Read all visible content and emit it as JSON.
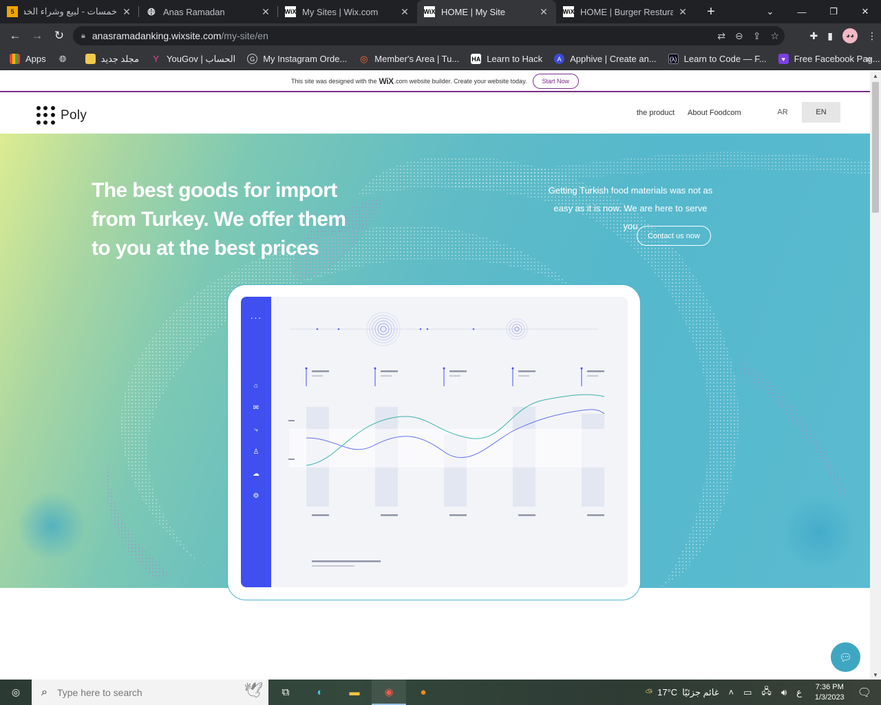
{
  "browser": {
    "tabs": [
      {
        "title": "خمسات - لبيع وشراء الخدمات",
        "favicon": "5",
        "active": false,
        "favicon_bg": "#f0a500"
      },
      {
        "title": "Anas Ramadan",
        "favicon": "globe",
        "active": false
      },
      {
        "title": "My Sites | Wix.com",
        "favicon": "WiX",
        "active": false
      },
      {
        "title": "HOME | My Site",
        "favicon": "WiX",
        "active": true
      },
      {
        "title": "HOME | Burger Resturant",
        "favicon": "WiX",
        "active": false
      }
    ],
    "url_domain": "anasramadanking.wixsite.com",
    "url_path": "/my-site/en",
    "bookmarks": [
      {
        "label": "Apps",
        "icon": "apps-grid-icon"
      },
      {
        "label": "",
        "icon": "globe-icon"
      },
      {
        "label": "مجلد جديد",
        "icon": "folder-icon"
      },
      {
        "label": "YouGov | الحساب",
        "icon": "yougov-icon"
      },
      {
        "label": "My Instagram Orde...",
        "icon": "instagram-orders-icon"
      },
      {
        "label": "Member's Area | Tu...",
        "icon": "members-icon"
      },
      {
        "label": "Learn to Hack",
        "icon": "hack-icon"
      },
      {
        "label": "Apphive | Create an...",
        "icon": "apphive-icon"
      },
      {
        "label": "Learn to Code — F...",
        "icon": "code-icon"
      },
      {
        "label": "Free Facebook Pag...",
        "icon": "heart-icon"
      }
    ]
  },
  "wix_banner": {
    "prefix": "This site was designed with the",
    "brand": "WiX",
    "suffix": ".com website builder. Create your website today.",
    "button": "Start Now"
  },
  "site": {
    "logo_text": "Poly",
    "menu": [
      "the product",
      "About Foodcom"
    ],
    "languages": [
      "AR",
      "EN"
    ],
    "selected_language": "EN",
    "hero_headline": "The best goods for import from Turkey. We offer them to you at the best prices",
    "hero_subtext": "Getting Turkish food materials was not as easy as it is now. We are here to serve you",
    "cta_label": "Contact us now"
  },
  "taskbar": {
    "search_placeholder": "Type here to search",
    "weather": "17°C",
    "weather_text": "غائم جزئيًا",
    "lang_indicator": "ع",
    "time": "7:36 PM",
    "date": "1/3/2023"
  },
  "colors": {
    "accent_purple": "#7a2a88",
    "sidebar_blue": "#3f4ff0",
    "hero_teal": "#55b8cc",
    "chat_button": "#3fa6c2"
  }
}
